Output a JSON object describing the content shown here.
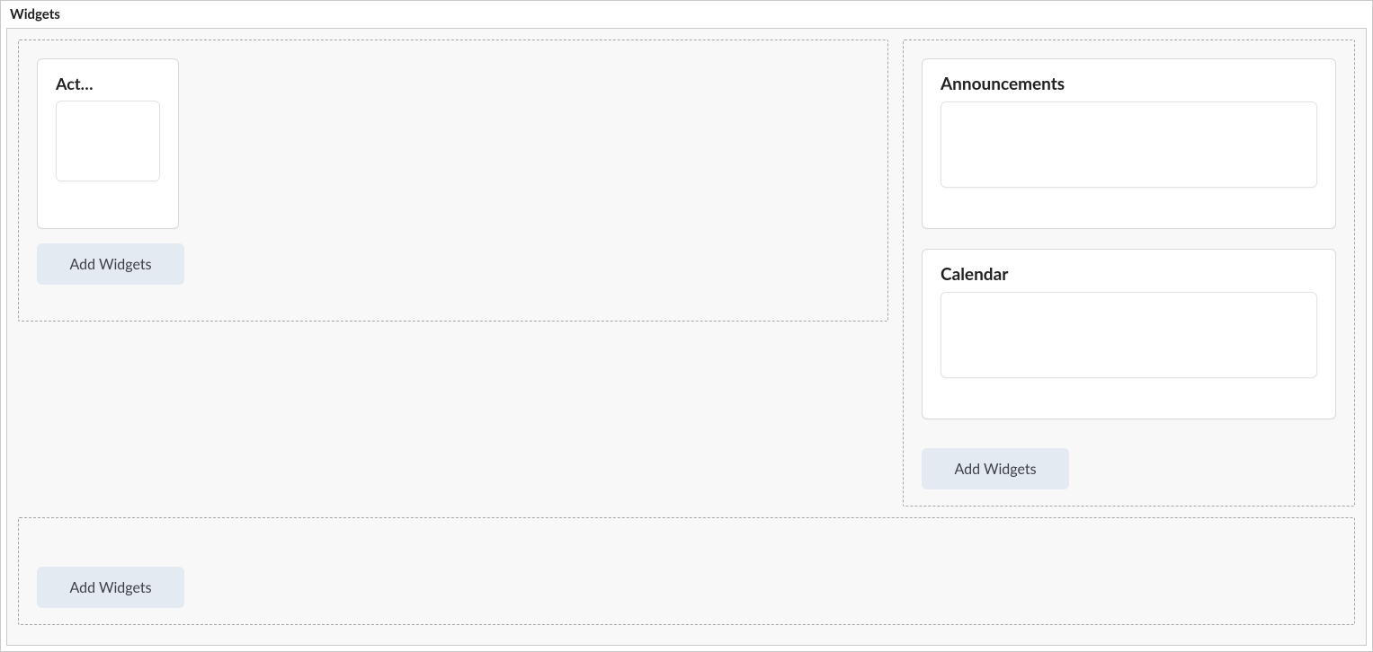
{
  "section_title": "Widgets",
  "zones": {
    "left": {
      "widgets": [
        {
          "title": "Act…"
        }
      ],
      "add_button_label": "Add Widgets"
    },
    "right": {
      "widgets": [
        {
          "title": "Announcements"
        },
        {
          "title": "Calendar"
        }
      ],
      "add_button_label": "Add Widgets"
    },
    "bottom": {
      "widgets": [],
      "add_button_label": "Add Widgets"
    }
  }
}
